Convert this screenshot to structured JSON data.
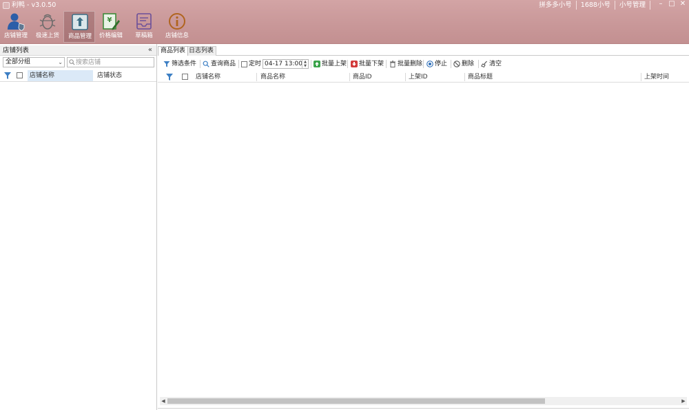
{
  "app": {
    "title": "利鸭 - v3.0.50"
  },
  "top_links": [
    "拼多多小号",
    "1688小号",
    "小号管理"
  ],
  "toolbar": [
    {
      "label": "店铺管理",
      "icon": "user-shield-icon",
      "color": "#2c5ea8"
    },
    {
      "label": "极速上货",
      "icon": "bug-icon",
      "color": "#6b6b6b"
    },
    {
      "label": "商品管理",
      "icon": "box-upload-icon",
      "color": "#3d6f86",
      "selected": true
    },
    {
      "label": "价格编辑",
      "icon": "yen-edit-icon",
      "color": "#3f8a3a"
    },
    {
      "label": "草稿箱",
      "icon": "draft-box-icon",
      "color": "#6a4f9a"
    },
    {
      "label": "店铺信息",
      "icon": "info-icon",
      "color": "#b0641e"
    }
  ],
  "shop_panel": {
    "title": "店铺列表",
    "collapse": "«",
    "group_select": "全部分组",
    "search_placeholder": "搜索店铺",
    "columns": [
      "店铺名称",
      "店铺状态"
    ]
  },
  "tabs": [
    "商品列表",
    "日志列表"
  ],
  "actions": {
    "filter": "筛选条件",
    "query": "查询商品",
    "timer": "定时",
    "datetime": "04-17 13:00",
    "batch_on": "批量上架",
    "batch_off": "批量下架",
    "batch_delete": "批量删除",
    "stop": "停止",
    "delete": "删除",
    "clear": "清空"
  },
  "product_table": {
    "columns": [
      "店铺名称",
      "商品名称",
      "商品ID",
      "上架ID",
      "商品标题",
      "上架时间"
    ]
  }
}
